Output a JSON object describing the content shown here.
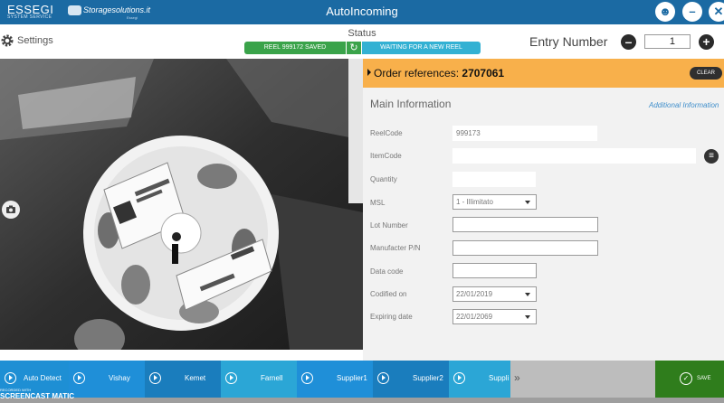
{
  "titlebar": {
    "brand": "ESSEGI",
    "brand_sub": "SYSTEM SERVICE",
    "brand2": "Storagesolutions.it",
    "brand2_sub": "Essegi",
    "title": "AutoIncoming"
  },
  "topbar": {
    "settings_label": "Settings",
    "status_title": "Status",
    "status_saved": "REEL 999172 SAVED",
    "status_waiting": "WAITING FOR A NEW REEL",
    "entry_label": "Entry Number",
    "entry_value": "1"
  },
  "order": {
    "label": "Order references:",
    "number": "2707061",
    "clear": "CLEAR"
  },
  "form": {
    "main_info": "Main Information",
    "additional_info": "Additional Information",
    "fields": {
      "reelcode_label": "ReelCode",
      "reelcode_value": "999173",
      "itemcode_label": "ItemCode",
      "itemcode_value": "",
      "quantity_label": "Quantity",
      "quantity_value": "",
      "msl_label": "MSL",
      "msl_value": "1 - Illimitato",
      "lot_label": "Lot Number",
      "lot_value": "",
      "manufacter_label": "Manufacter P/N",
      "manufacter_value": "",
      "datacode_label": "Data code",
      "datacode_value": "",
      "codified_label": "Codified on",
      "codified_value": "22/01/2019",
      "expiring_label": "Expiring date",
      "expiring_value": "22/01/2069"
    }
  },
  "suppliers": [
    "Auto Detect",
    "Vishay",
    "Kemet",
    "Farnell",
    "Supplier1",
    "Supplier2",
    "Suppli"
  ],
  "supplier_colors": [
    "#1e8fd4",
    "#1f8fd8",
    "#1a7dbd",
    "#2ba6d6",
    "#1f8fd8",
    "#1a7dbd",
    "#2ba6d6"
  ],
  "save_label": "SAVE",
  "watermark": {
    "line1": "RECORDED WITH",
    "line2": "SCREENCAST MATIC"
  },
  "colors": {
    "title_blue": "#1b6aa3",
    "order_orange": "#f8b04b",
    "status_green": "#3aa34a",
    "status_cyan": "#33b1d3",
    "save_green": "#2f7d1c"
  }
}
